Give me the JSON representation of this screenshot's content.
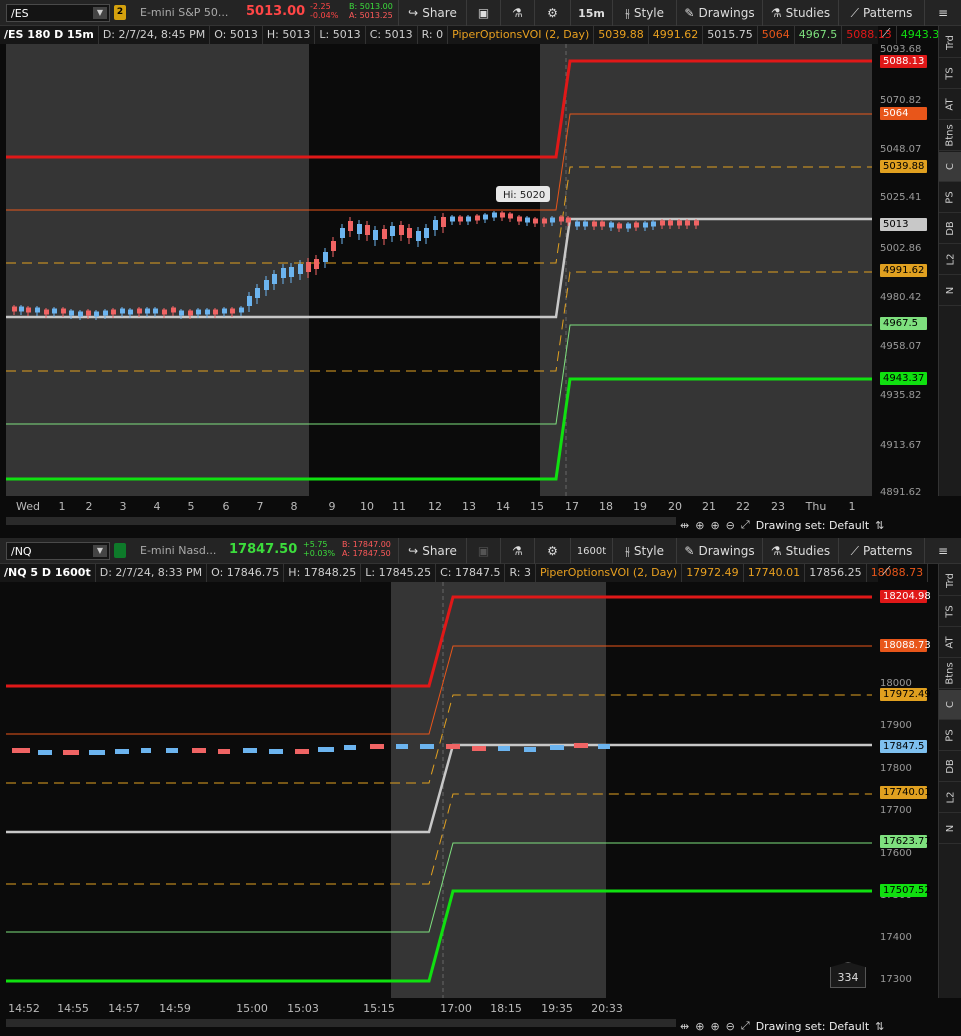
{
  "es": {
    "symbol": "/ES",
    "link_badge": "2",
    "description": "E-mini S&P 50...",
    "last": "5013.00",
    "change": "-2.25",
    "change_pct": "-0.04%",
    "bid": "B: 5013.00",
    "ask": "A: 5013.25",
    "interval": "15m",
    "header": [
      "/ES 180 D 15m",
      "D: 2/7/24, 8:45 PM",
      "O: 5013",
      "H: 5013",
      "L: 5013",
      "C: 5013",
      "R: 0"
    ],
    "study": [
      "PiperOptionsVOI (2, Day)",
      "5039.88",
      "4991.62",
      "5015.75",
      "5064",
      "4967.5",
      "5088.13",
      "4943.37"
    ],
    "y_ticks": [
      "5093.68",
      "5070.82",
      "5048.07",
      "5025.41",
      "5002.86",
      "4980.42",
      "4958.07",
      "4935.82",
      "4913.67",
      "4891.62"
    ],
    "tags": [
      "5088.13",
      "5064",
      "5039.88",
      "5013",
      "4991.62",
      "4967.5",
      "4943.37"
    ],
    "x_ticks": [
      "Wed",
      "1",
      "2",
      "3",
      "4",
      "5",
      "6",
      "7",
      "8",
      "9",
      "10",
      "11",
      "12",
      "13",
      "14",
      "15",
      "17",
      "18",
      "19",
      "20",
      "21",
      "22",
      "23",
      "Thu",
      "1"
    ],
    "bubble": "Hi: 5020",
    "drawing_set": "Drawing set: Default"
  },
  "nq": {
    "symbol": "/NQ",
    "description": "E-mini Nasd...",
    "last": "17847.50",
    "change": "+5.75",
    "change_pct": "+0.03%",
    "bid": "B: 17847.00",
    "ask": "A: 17847.50",
    "interval": "1600t",
    "header": [
      "/NQ 5 D 1600t",
      "D: 2/7/24, 8:33 PM",
      "O: 17846.75",
      "H: 17848.25",
      "L: 17845.25",
      "C: 17847.5",
      "R: 3"
    ],
    "study": [
      "PiperOptionsVOI (2, Day)",
      "17972.49",
      "17740.01",
      "17856.25",
      "18088.73"
    ],
    "y_ticks": [
      "18000",
      "17900",
      "17800",
      "17700",
      "17600",
      "17500",
      "17400",
      "17300"
    ],
    "tags": [
      "18204.98",
      "18088.73",
      "17972.49",
      "17847.5",
      "17740.01",
      "17623.77",
      "17507.52"
    ],
    "x_ticks": [
      "14:52",
      "14:55",
      "14:57",
      "14:59",
      "15:00",
      "15:03",
      "15:15",
      "17:00",
      "18:15",
      "19:35",
      "20:33"
    ],
    "counter": "334",
    "drawing_set": "Drawing set: Default"
  },
  "toolbar": {
    "share": "Share",
    "style": "Style",
    "drawings": "Drawings",
    "studies": "Studies",
    "patterns": "Patterns"
  },
  "side_tabs": [
    "Trd",
    "TS",
    "AT",
    "Btns",
    "C",
    "PS",
    "DB",
    "L2",
    "N"
  ],
  "colors": {
    "red": "#e01818",
    "orange": "#e8561a",
    "amber": "#e0a020",
    "gray": "#c8c8c8",
    "lightgreen": "#7ee07e",
    "green": "#10e010"
  }
}
